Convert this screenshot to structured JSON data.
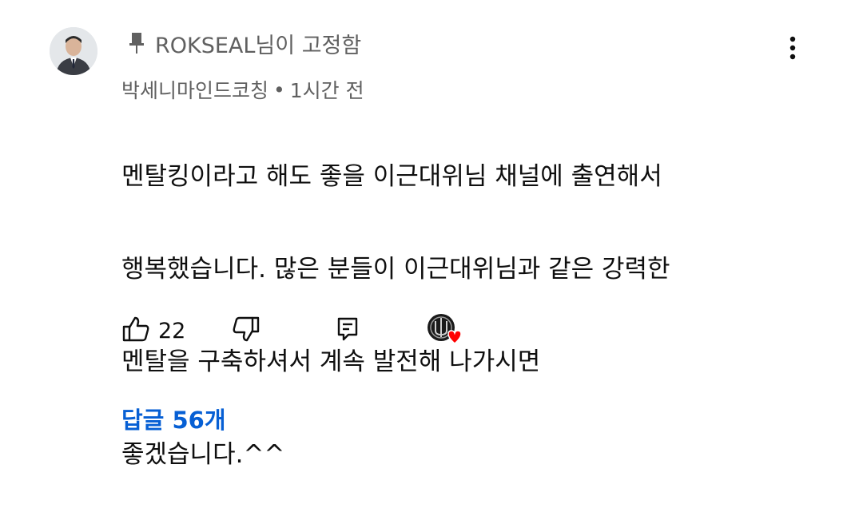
{
  "comment": {
    "pinned_by_text": "ROKSEAL님이 고정함",
    "author": "박세니마인드코칭",
    "separator": "•",
    "timestamp": "1시간 전",
    "text_lines": [
      "멘탈킹이라고 해도 좋을 이근대위님 채널에 출연해서",
      "행복했습니다. 많은 분들이 이근대위님과 같은 강력한",
      "멘탈을 구축하셔서 계속 발전해 나가시면",
      "좋겠습니다.^^"
    ],
    "like_count": "22",
    "replies_label": "답글 56개"
  },
  "icons": {
    "pin": "pin-icon",
    "more": "more-vert-icon",
    "like": "thumbs-up-icon",
    "dislike": "thumbs-down-icon",
    "reply": "reply-comment-icon",
    "creator_heart": "creator-heart-icon"
  },
  "colors": {
    "text_primary": "#0f0f0f",
    "text_secondary": "#606060",
    "link_blue": "#065fd4",
    "heart_red": "#ff0000"
  }
}
